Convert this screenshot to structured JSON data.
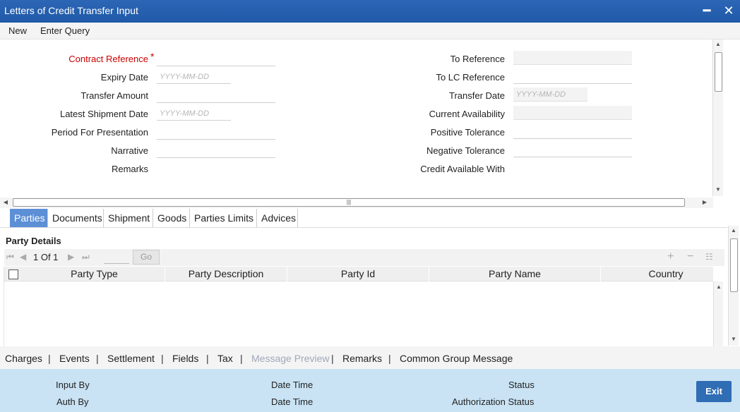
{
  "window": {
    "title": "Letters of Credit Transfer Input",
    "minimize_glyph": "━",
    "close_glyph": "✕"
  },
  "menu": {
    "new": "New",
    "enter_query": "Enter Query"
  },
  "form": {
    "contract_reference": "Contract Reference",
    "required_mark": "*",
    "expiry_date": "Expiry Date",
    "transfer_amount": "Transfer Amount",
    "latest_shipment_date": "Latest Shipment Date",
    "period_for_presentation": "Period For Presentation",
    "narrative": "Narrative",
    "remarks": "Remarks",
    "to_reference": "To Reference",
    "to_lc_reference": "To LC Reference",
    "transfer_date": "Transfer Date",
    "current_availability": "Current Availability",
    "positive_tolerance": "Positive Tolerance",
    "negative_tolerance": "Negative Tolerance",
    "credit_available_with": "Credit Available With",
    "date_placeholder": "YYYY-MM-DD"
  },
  "tabs": [
    "Parties",
    "Documents",
    "Shipment",
    "Goods",
    "Parties Limits",
    "Advices"
  ],
  "party_details": {
    "title": "Party Details",
    "pager_text": "1 Of 1",
    "go_label": "Go",
    "columns": [
      "Party Type",
      "Party Description",
      "Party Id",
      "Party Name",
      "Country"
    ]
  },
  "bottom_links": {
    "charges": "Charges",
    "events": "Events",
    "settlement": "Settlement",
    "fields": "Fields",
    "tax": "Tax",
    "message_preview": "Message Preview",
    "remarks": "Remarks",
    "common_group_message": "Common Group Message",
    "separator": "|"
  },
  "audit": {
    "input_by": "Input By",
    "auth_by": "Auth By",
    "date_time_1": "Date Time",
    "date_time_2": "Date Time",
    "status": "Status",
    "authorization_status": "Authorization Status",
    "exit": "Exit"
  },
  "colors": {
    "titlebar": "#2c66b5",
    "active_tab": "#5c8fd6",
    "audit_panel": "#c9e3f4",
    "exit_button": "#2f6db5",
    "required": "#cc0000"
  }
}
